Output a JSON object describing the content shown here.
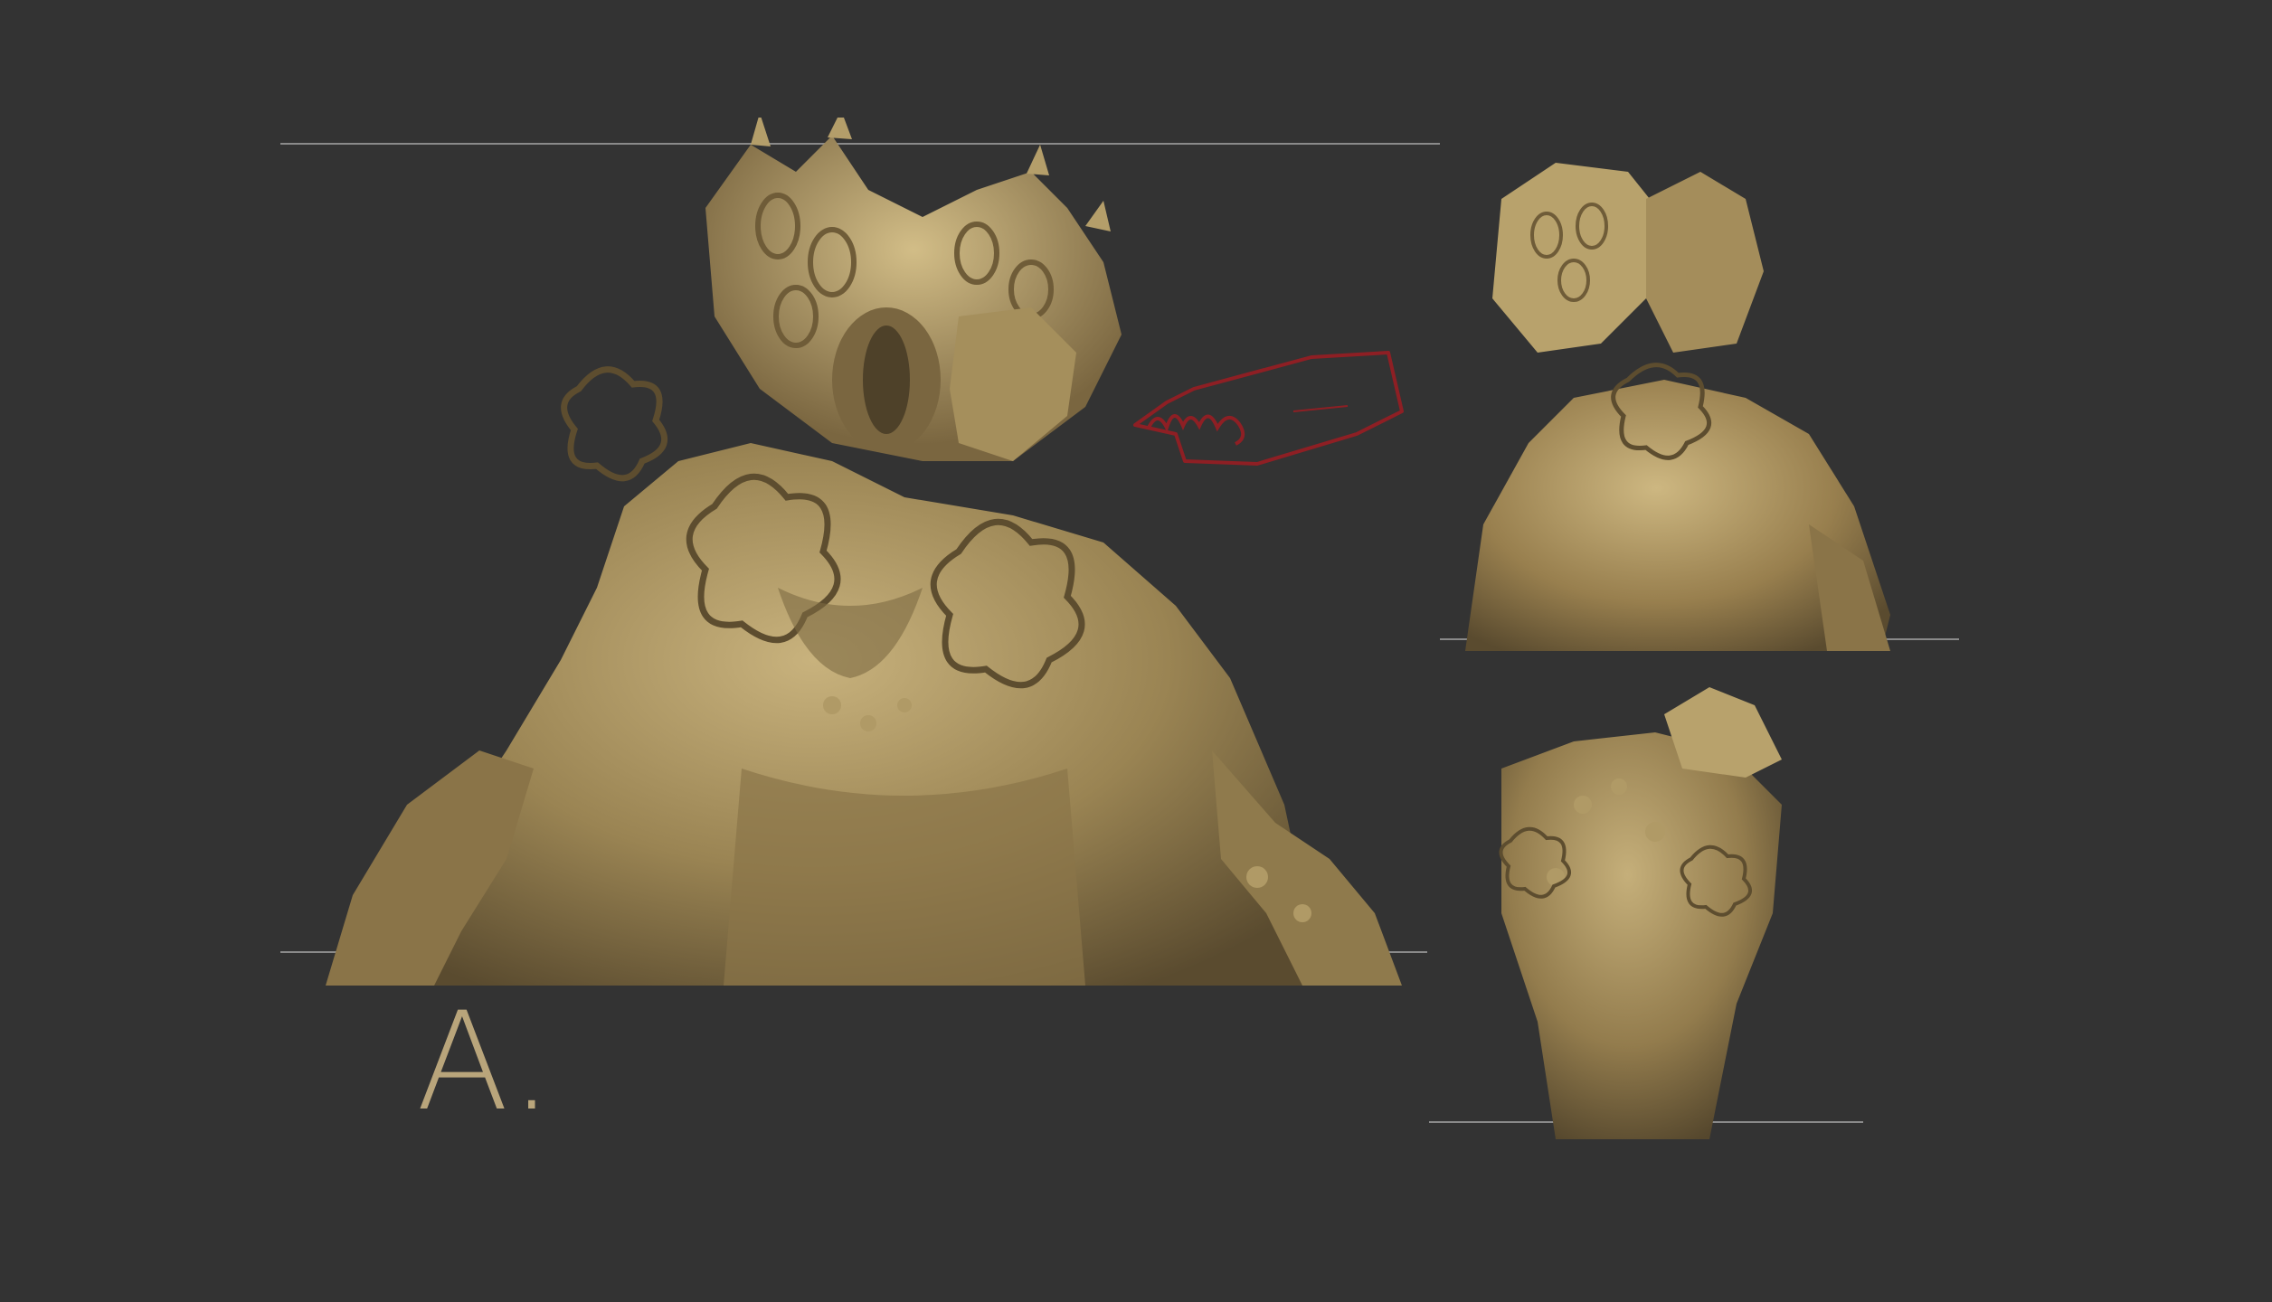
{
  "caption": "A.",
  "colors": {
    "background": "#333333",
    "clay": "#8f7a4c",
    "clay_highlight": "#c8b27d",
    "clay_shadow": "#4e4129",
    "guide_line": "#8a8a8a",
    "annotation_red": "#8e1f24",
    "caption": "#b9a57b"
  },
  "views": [
    {
      "name": "main-front-view"
    },
    {
      "name": "three-quarter-view"
    },
    {
      "name": "back-view"
    }
  ],
  "annotation": {
    "shape": "red hand-drawn speech bubble with scribble"
  }
}
